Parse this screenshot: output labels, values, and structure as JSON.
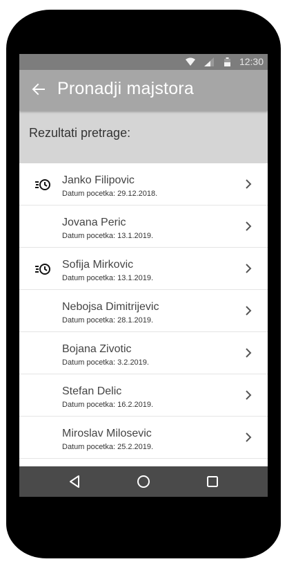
{
  "status_bar": {
    "time": "12:30",
    "icons": [
      "wifi-icon",
      "signal-icon",
      "battery-icon"
    ]
  },
  "app_bar": {
    "title": "Pronadji majstora",
    "back_icon": "arrow-left-icon"
  },
  "subheader": {
    "label": "Rezultati pretrage:"
  },
  "results": [
    {
      "name": "Janko Filipovic",
      "date": "Datum pocetka: 29.12.2018.",
      "icon": "history-icon"
    },
    {
      "name": "Jovana Peric",
      "date": "Datum pocetka: 13.1.2019.",
      "icon": ""
    },
    {
      "name": "Sofija Mirkovic",
      "date": "Datum pocetka: 13.1.2019.",
      "icon": "history-icon"
    },
    {
      "name": "Nebojsa Dimitrijevic",
      "date": "Datum pocetka: 28.1.2019.",
      "icon": ""
    },
    {
      "name": "Bojana Zivotic",
      "date": "Datum pocetka: 3.2.2019.",
      "icon": ""
    },
    {
      "name": "Stefan Delic",
      "date": "Datum pocetka: 16.2.2019.",
      "icon": ""
    },
    {
      "name": "Miroslav Milosevic",
      "date": "Datum pocetka: 25.2.2019.",
      "icon": ""
    }
  ],
  "nav_bar": {
    "buttons": [
      "back-triangle-icon",
      "home-circle-icon",
      "recents-square-icon"
    ]
  },
  "colors": {
    "status_bar": "#7d7d7d",
    "app_bar": "#a6a6a6",
    "subheader": "#d5d5d5",
    "nav_bar": "#4a4a4a"
  }
}
